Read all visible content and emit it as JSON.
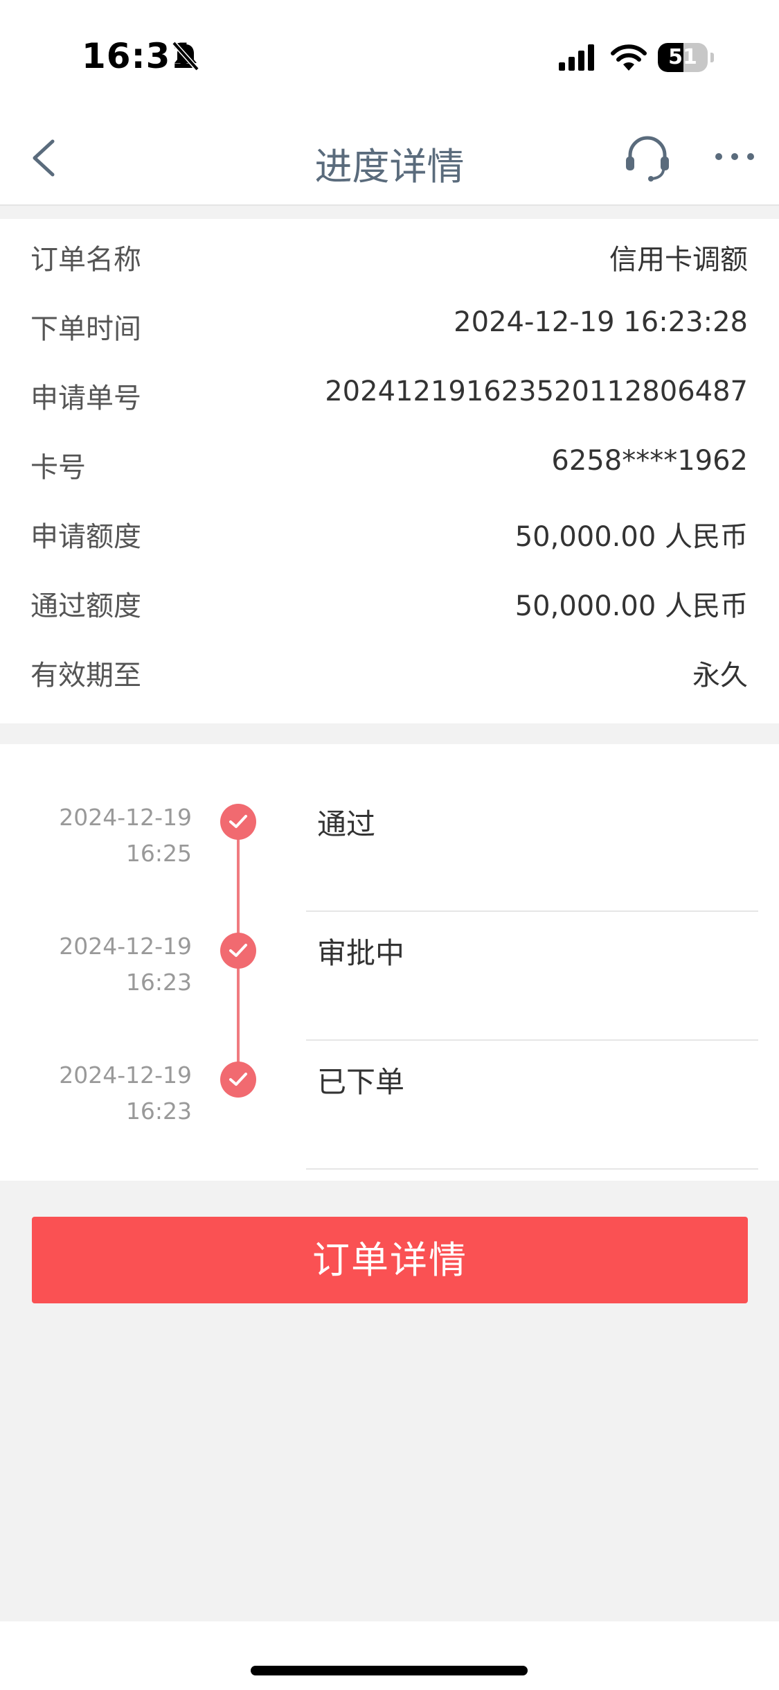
{
  "status_bar": {
    "time": "16:31",
    "battery": "51",
    "battery_level": 0.51
  },
  "nav": {
    "title": "进度详情"
  },
  "info": {
    "rows": [
      {
        "label": "订单名称",
        "value": "信用卡调额"
      },
      {
        "label": "下单时间",
        "value": "2024-12-19 16:23:28"
      },
      {
        "label": "申请单号",
        "value": "20241219162352011280648​7"
      },
      {
        "label": "卡号",
        "value": "6258****1962"
      },
      {
        "label": "申请额度",
        "value": "50,000.00 人民币"
      },
      {
        "label": "通过额度",
        "value": "50,000.00 人民币"
      },
      {
        "label": "有效期至",
        "value": "永久"
      }
    ]
  },
  "timeline": {
    "items": [
      {
        "date": "2024-12-19",
        "time": "16:25",
        "status": "通过"
      },
      {
        "date": "2024-12-19",
        "time": "16:23",
        "status": "审批中"
      },
      {
        "date": "2024-12-19",
        "time": "16:23",
        "status": "已下单"
      }
    ]
  },
  "actions": {
    "order_details_label": "订单详情"
  },
  "colors": {
    "accent_red": "#fa5153",
    "timeline_red": "#f16a70",
    "title_gray": "#5a6b7c"
  }
}
